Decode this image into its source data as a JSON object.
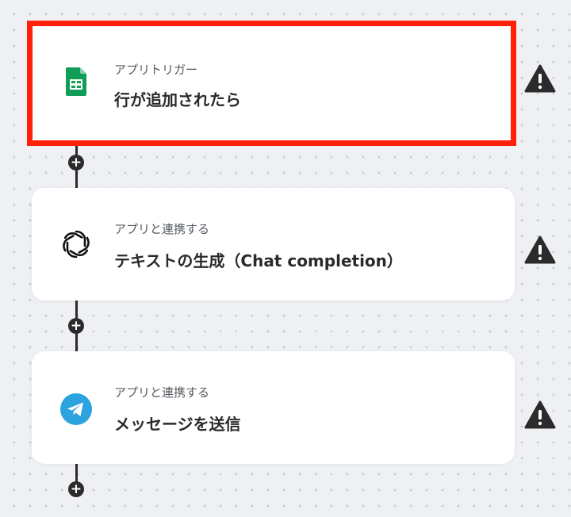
{
  "steps": [
    {
      "subtitle": "アプリトリガー",
      "title": "行が追加されたら",
      "icon": "google-sheets-icon",
      "selected": true,
      "warning": true
    },
    {
      "subtitle": "アプリと連携する",
      "title": "テキストの生成（Chat completion）",
      "icon": "openai-icon",
      "selected": false,
      "warning": true
    },
    {
      "subtitle": "アプリと連携する",
      "title": "メッセージを送信",
      "icon": "telegram-icon",
      "selected": false,
      "warning": true
    }
  ],
  "add_step_label": "+",
  "colors": {
    "selection_border": "#ff1f0a",
    "sheets_green": "#0f9d58",
    "telegram_blue": "#2aa3df",
    "warning_dark": "#2b2b2b",
    "canvas_bg": "#eef0f3"
  }
}
